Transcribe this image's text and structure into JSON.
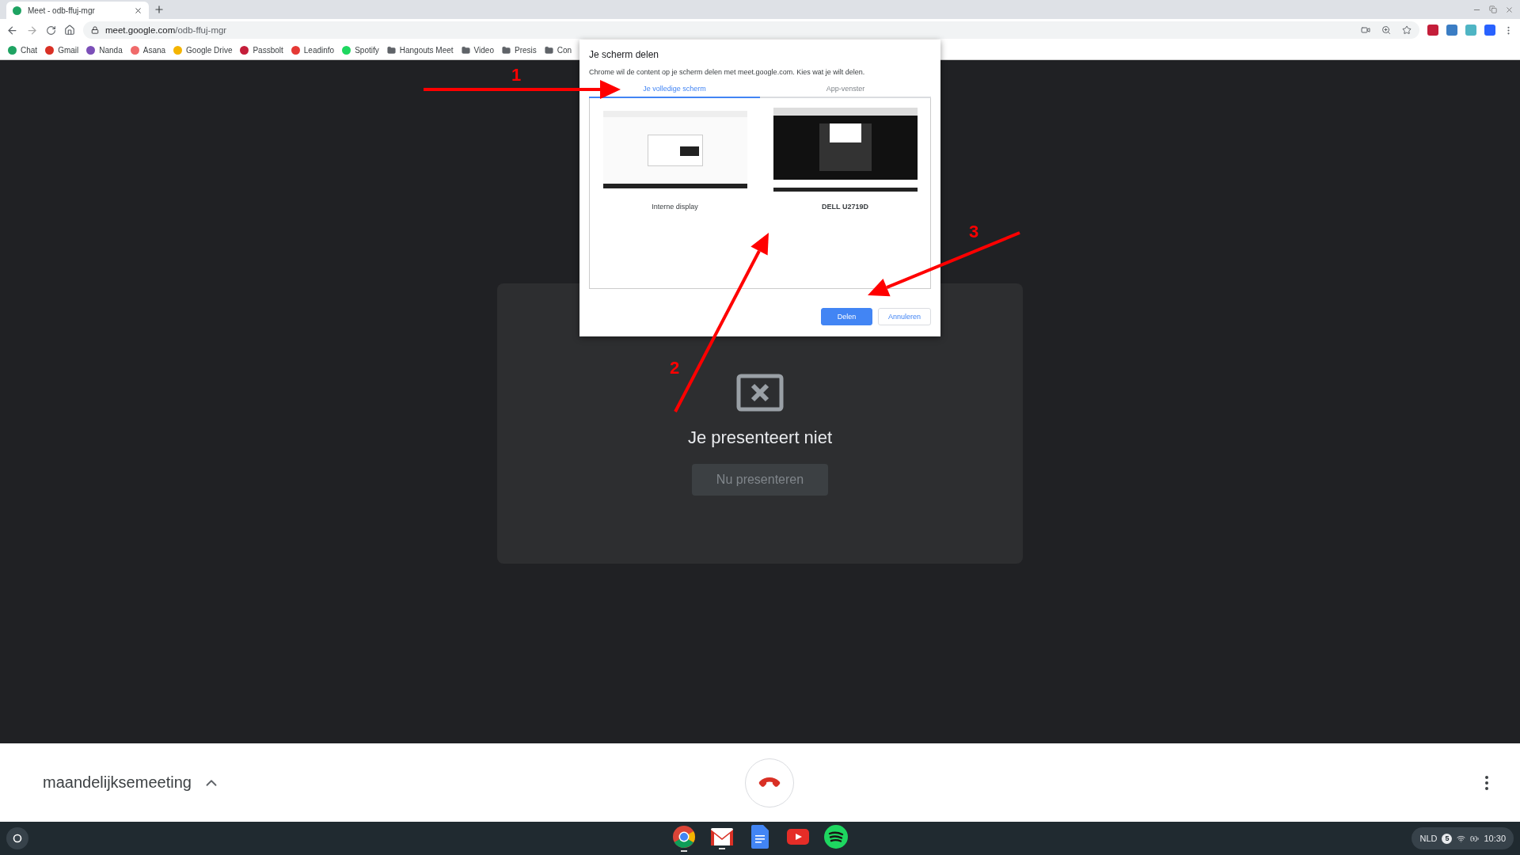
{
  "browser": {
    "tab": {
      "title": "Meet - odb-ffuj-mgr",
      "selected": true
    },
    "address": {
      "host": "meet.google.com",
      "path": "/odb-ffuj-mgr"
    },
    "bookmarks": [
      {
        "label": "Chat",
        "kind": "site",
        "color": "#1ea362"
      },
      {
        "label": "Gmail",
        "kind": "site",
        "color": "#d93025"
      },
      {
        "label": "Nanda",
        "kind": "site",
        "color": "#7b4fb8"
      },
      {
        "label": "Asana",
        "kind": "site",
        "color": "#f06a6a"
      },
      {
        "label": "Google Drive",
        "kind": "site",
        "color": "#f4b400"
      },
      {
        "label": "Passbolt",
        "kind": "site",
        "color": "#c41e3a"
      },
      {
        "label": "Leadinfo",
        "kind": "site",
        "color": "#e53935"
      },
      {
        "label": "Spotify",
        "kind": "site",
        "color": "#1ed760"
      },
      {
        "label": "Hangouts Meet",
        "kind": "folder"
      },
      {
        "label": "Video",
        "kind": "folder"
      },
      {
        "label": "Presis",
        "kind": "folder"
      },
      {
        "label": "Con",
        "kind": "folder"
      }
    ]
  },
  "dialog": {
    "title": "Je scherm delen",
    "message": "Chrome wil de content op je scherm delen met meet.google.com. Kies wat je wilt delen.",
    "tabs": [
      {
        "label": "Je volledige scherm",
        "selected": true
      },
      {
        "label": "App-venster",
        "selected": false
      }
    ],
    "sources": [
      {
        "label": "Interne display",
        "kind": "light",
        "selected": false
      },
      {
        "label": "DELL U2719D",
        "kind": "dark",
        "selected": true
      }
    ],
    "buttons": [
      {
        "label": "Delen",
        "kind": "primary"
      },
      {
        "label": "Annuleren",
        "kind": "secondary"
      }
    ]
  },
  "presentation": {
    "message": "Je presenteert niet",
    "button": {
      "label": "Nu presenteren",
      "disabled": true
    }
  },
  "annotations": [
    {
      "label": "1"
    },
    {
      "label": "2"
    },
    {
      "label": "3"
    }
  ],
  "meeting": {
    "title": "maandelijksemeeting"
  },
  "shelf": {
    "apps": [
      {
        "kind": "chrome",
        "running": true
      },
      {
        "kind": "gmail",
        "running": true
      },
      {
        "kind": "docs",
        "running": false
      },
      {
        "kind": "youtube",
        "running": false
      },
      {
        "kind": "spotify",
        "running": false
      }
    ],
    "tray": {
      "language": "NLD",
      "notifications": "5",
      "time": "10:30"
    }
  }
}
